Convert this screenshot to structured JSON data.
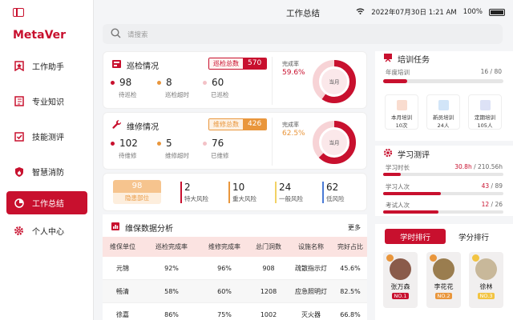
{
  "app": {
    "logo": "MetaVer"
  },
  "sidebar": {
    "items": [
      {
        "label": "工作助手",
        "icon": "star-bookmark-icon",
        "active": false
      },
      {
        "label": "专业知识",
        "icon": "book-icon",
        "active": false
      },
      {
        "label": "技能测评",
        "icon": "checklist-icon",
        "active": false
      },
      {
        "label": "智慧消防",
        "icon": "fire-shield-icon",
        "active": false
      },
      {
        "label": "工作总结",
        "icon": "pie-chart-icon",
        "active": true
      },
      {
        "label": "个人中心",
        "icon": "gear-icon",
        "active": false
      }
    ]
  },
  "status_bar": {
    "datetime": "2022年07月30日 1:21 AM",
    "battery": "100%"
  },
  "header": {
    "title": "工作总结"
  },
  "search": {
    "placeholder": "请搜索"
  },
  "inspection": {
    "title": "巡检情况",
    "total_label": "巡检总数",
    "total": "570",
    "stats": [
      {
        "value": "98",
        "label": "待巡检"
      },
      {
        "value": "8",
        "label": "巡检超时"
      },
      {
        "value": "60",
        "label": "已巡检"
      }
    ],
    "rate_label": "完成率",
    "rate": "59.6%",
    "rate_value": 0.596,
    "donut_label": "当月"
  },
  "maintenance": {
    "title": "维修情况",
    "total_label": "维修总数",
    "total": "426",
    "stats": [
      {
        "value": "102",
        "label": "待维修"
      },
      {
        "value": "5",
        "label": "维修超时"
      },
      {
        "value": "76",
        "label": "已维修"
      }
    ],
    "rate_label": "完成率",
    "rate": "62.5%",
    "rate_value": 0.625,
    "donut_label": "当月"
  },
  "hazards": {
    "count": "98",
    "label": "隐患部位",
    "risks": [
      {
        "value": "2",
        "label": "特大风险"
      },
      {
        "value": "10",
        "label": "重大风险"
      },
      {
        "value": "24",
        "label": "一般风险"
      },
      {
        "value": "62",
        "label": "低风险"
      }
    ]
  },
  "analysis": {
    "title": "维保数据分析",
    "more": "更多",
    "columns": [
      "维保单位",
      "巡检完成率",
      "维修完成率",
      "总门洞数",
      "设施名称",
      "完好占比"
    ],
    "rows": [
      [
        "元锦",
        "92%",
        "96%",
        "908",
        "疏散指示灯",
        "45.6%"
      ],
      [
        "畅清",
        "58%",
        "60%",
        "1208",
        "应急照明灯",
        "82.5%"
      ],
      [
        "徐嘉",
        "86%",
        "75%",
        "1002",
        "灭火器",
        "66.8%"
      ]
    ]
  },
  "training": {
    "title": "培训任务",
    "annual_label": "年度培训",
    "annual_value": "16 / 80",
    "annual_progress": 0.2,
    "items": [
      {
        "name": "本月培训",
        "count": "10次"
      },
      {
        "name": "新员培训",
        "count": "24人"
      },
      {
        "name": "定期培训",
        "count": "105人"
      }
    ]
  },
  "learning": {
    "title": "学习测评",
    "rows": [
      {
        "label": "学习时长",
        "value_hl": "30.8h",
        "value_rest": " / 210.56h",
        "progress": 0.146
      },
      {
        "label": "学习人次",
        "value_hl": "43",
        "value_rest": " / 89",
        "progress": 0.483
      },
      {
        "label": "考试人次",
        "value_hl": "12",
        "value_rest": " / 26",
        "progress": 0.462
      }
    ]
  },
  "ranking": {
    "tabs": [
      "学时排行",
      "学分排行"
    ],
    "people": [
      {
        "name": "张万森",
        "rank": "NO.1"
      },
      {
        "name": "李花花",
        "rank": "NO.2"
      },
      {
        "name": "徐林",
        "rank": "NO.3"
      }
    ]
  },
  "colors": {
    "accent": "#c8102e",
    "orange": "#e9963c",
    "blue": "#4a7bd6"
  }
}
